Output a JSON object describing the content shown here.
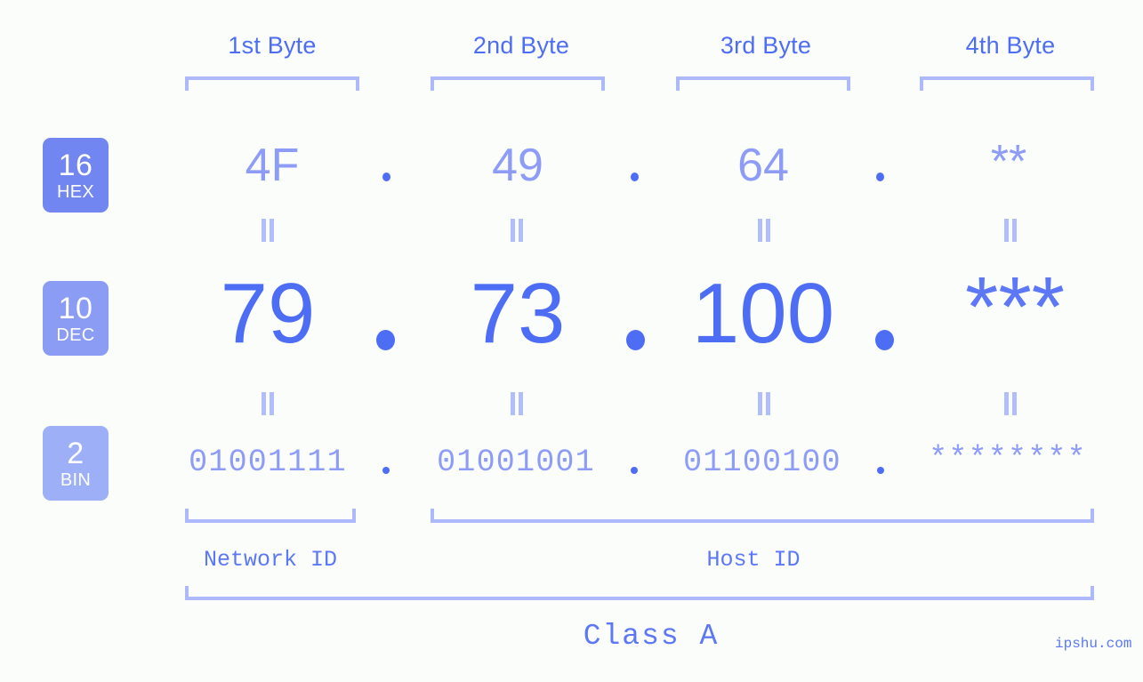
{
  "accent": {
    "strong": "#4d6df5",
    "light": "#8d9cf7",
    "bracket": "#aeb9fb",
    "badge_hex": "#7186f0",
    "badge_dec": "#8b9cf5",
    "badge_bin": "#9db0f7",
    "background": "#fbfdfa"
  },
  "byte_headers": [
    {
      "label": "1st Byte"
    },
    {
      "label": "2nd Byte"
    },
    {
      "label": "3rd Byte"
    },
    {
      "label": "4th Byte"
    }
  ],
  "rows": [
    {
      "badge_number": "16",
      "badge_name": "HEX",
      "values": [
        "4F",
        "49",
        "64",
        "**"
      ]
    },
    {
      "badge_number": "10",
      "badge_name": "DEC",
      "values": [
        "79",
        "73",
        "100",
        "***"
      ]
    },
    {
      "badge_number": "2",
      "badge_name": "BIN",
      "values": [
        "01001111",
        "01001001",
        "01100100",
        "********"
      ]
    }
  ],
  "separator": ".",
  "equality_marker": "=",
  "segments": {
    "network_id": "Network ID",
    "host_id": "Host ID",
    "class": "Class A"
  },
  "watermark": "ipshu.com"
}
